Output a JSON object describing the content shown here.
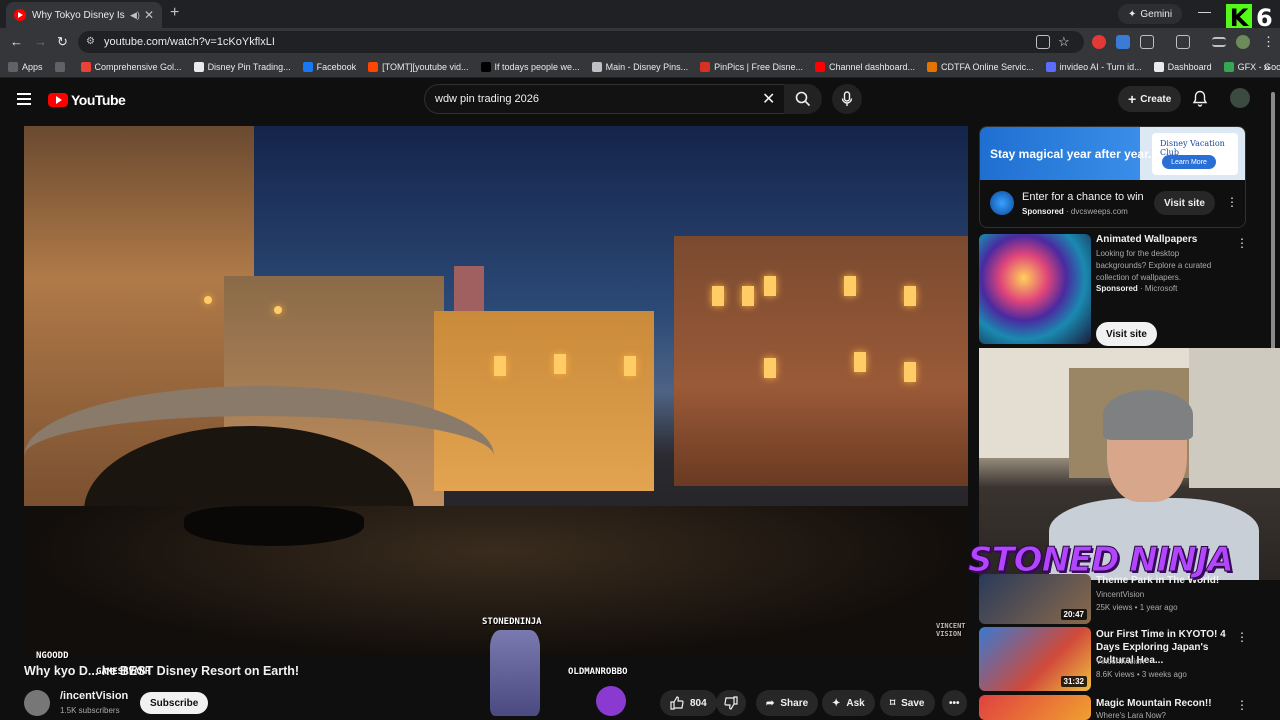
{
  "browser": {
    "tab_title": "Why Tokyo Disney Is the BE",
    "new_tab_icon": "plus-icon",
    "gemini_label": "Gemini",
    "badge_k": "K",
    "badge_num": "6",
    "url": "youtube.com/watch?v=1cKoYkflxLI",
    "bookmarks": [
      {
        "label": "Apps",
        "color": "#5f6368"
      },
      {
        "label": "",
        "color": "#5f6368"
      },
      {
        "label": "Comprehensive Gol...",
        "color": "#ea4335"
      },
      {
        "label": "Disney Pin Trading...",
        "color": "#e8eaed"
      },
      {
        "label": "Facebook",
        "color": "#1877f2"
      },
      {
        "label": "[TOMT][youtube vid...",
        "color": "#ff4500"
      },
      {
        "label": "If todays people we...",
        "color": "#000000"
      },
      {
        "label": "Main - Disney Pins...",
        "color": "#bdc1c6"
      },
      {
        "label": "PinPics | Free Disne...",
        "color": "#d93025"
      },
      {
        "label": "Channel dashboard...",
        "color": "#ff0000"
      },
      {
        "label": "CDTFA Online Servic...",
        "color": "#e37400"
      },
      {
        "label": "invideo AI - Turn id...",
        "color": "#5b6cff"
      },
      {
        "label": "Dashboard",
        "color": "#e8eaed"
      },
      {
        "label": "GFX - Google Drive",
        "color": "#34a853"
      }
    ]
  },
  "youtube": {
    "logo_text": "YouTube",
    "search_value": "wdw pin trading 2026",
    "create_label": "Create",
    "video_title_left": "Why",
    "video_title_right": "kyo D...  he BEST Disney Resort on Earth!",
    "channel_name": "/incentVision",
    "channel_subs": "1.5K subscribers",
    "subscribe_label": "Subscribe",
    "likes": "804",
    "share_label": "Share",
    "ask_label": "Ask",
    "save_label": "Save"
  },
  "overlay": {
    "ngoodd": "NGOODD",
    "gamesrvanh": "GAMESRVANH",
    "stonedninja_tag": "STONEDNINJA",
    "oldmanrobbo": "OLDMANROBBO",
    "webcam_title": "STONED NINJA",
    "watermark": "VINCENT VISION"
  },
  "sidebar": {
    "ad": {
      "banner_text": "Stay magical year after year.",
      "logo_text": "Disney Vacation Club",
      "learn_more": "Learn More",
      "title": "Enter for a chance to win",
      "sponsored": "Sponsored",
      "domain": "dvcsweeps.com",
      "visit": "Visit site"
    },
    "ad2": {
      "title": "Animated Wallpapers",
      "desc": "Looking for the desktop backgrounds? Explore a curated collection of wallpapers.",
      "sponsored": "Sponsored",
      "brand": "Microsoft",
      "visit": "Visit site"
    },
    "videos": [
      {
        "title": "Theme Park in The World!",
        "channel": "VincentVision",
        "meta": "25K views • 1 year ago",
        "duration": "20:47"
      },
      {
        "title": "Our First Time in KYOTO! 4 Days Exploring Japan's Cultural Hea...",
        "channel": "VincentVision",
        "meta": "8.6K views • 3 weeks ago",
        "duration": "31:32"
      },
      {
        "title": "Magic Mountain Recon!!",
        "channel": "Where's Lara Now?",
        "meta": "",
        "duration": ""
      }
    ]
  }
}
